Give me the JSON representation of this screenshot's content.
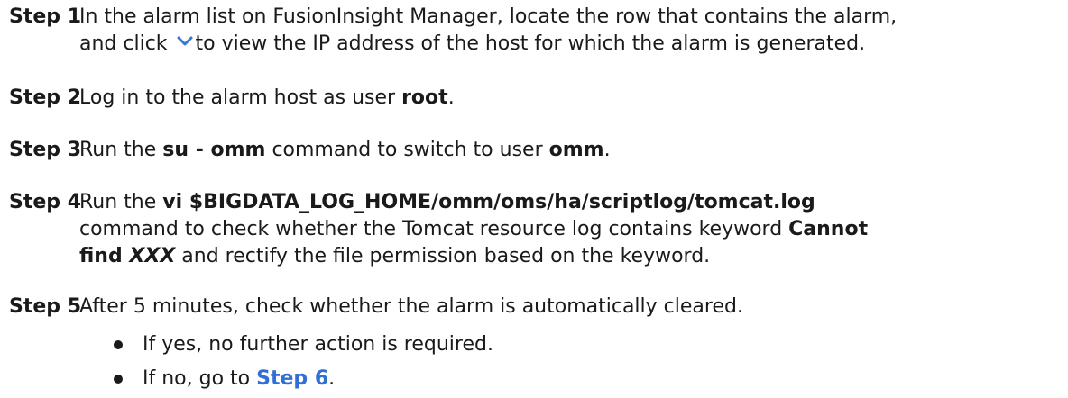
{
  "steps": [
    {
      "label": "Step 1",
      "line1": "In the alarm list on FusionInsight Manager, locate the row that contains the alarm,",
      "line2_pre": "and click",
      "line2_icon": "chevron-down-icon",
      "line2_post": "to view the IP address of the host for which the alarm is generated."
    },
    {
      "label": "Step 2",
      "pre": "Log in to the alarm host as user ",
      "bold": "root",
      "post": "."
    },
    {
      "label": "Step 3",
      "pre": "Run the ",
      "bold1": "su - omm",
      "mid": " command to switch to user ",
      "bold2": "omm",
      "post": "."
    },
    {
      "label": "Step 4",
      "pre": "Run the ",
      "bold1": "vi $BIGDATA_LOG_HOME/omm/oms/ha/scriptlog/tomcat.log",
      "line2_pre": "command to check whether the Tomcat resource log contains keyword ",
      "line2_bold": "Cannot",
      "line3_bold": "find ",
      "line3_ital": "XXX",
      "line3_post": " and rectify the file permission based on the keyword."
    },
    {
      "label": "Step 5",
      "text": "After 5 minutes, check whether the alarm is automatically cleared.",
      "bullets": [
        {
          "text": "If yes, no further action is required."
        },
        {
          "pre": "If no, go to ",
          "link": "Step 6",
          "post": "."
        }
      ]
    }
  ],
  "colors": {
    "text": "#1a1a1a",
    "link": "#2f6fd6",
    "chevron": "#3a78d8"
  }
}
